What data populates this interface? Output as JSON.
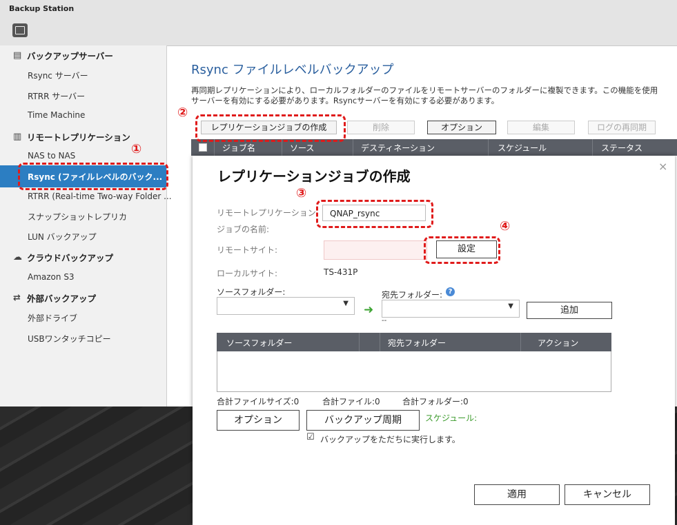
{
  "app": {
    "title": "Backup Station"
  },
  "sidebar": {
    "categories": [
      {
        "label": "バックアップサーバー",
        "icon": "server-icon"
      },
      {
        "label": "リモートレプリケーション",
        "icon": "replication-icon"
      },
      {
        "label": "クラウドバックアップ",
        "icon": "cloud-icon"
      },
      {
        "label": "外部バックアップ",
        "icon": "sync-icon"
      }
    ],
    "items": [
      "Rsync サーバー",
      "RTRR サーバー",
      "Time Machine",
      "NAS to NAS",
      "Rsync (ファイルレベルのバック...",
      "RTRR (Real-time Two-way Folder ...",
      "スナップショットレプリカ",
      "LUN バックアップ",
      "Amazon S3",
      "外部ドライブ",
      "USBワンタッチコピー"
    ]
  },
  "main": {
    "title": "Rsync ファイルレベルバックアップ",
    "description_line1": "再同期レプリケーションにより、ローカルフォルダーのファイルをリモートサーバーのフォルダーに複製できます。この機能を使用",
    "description_line2": "サーバーを有効にする必要があります。Rsyncサーバーを有効にする必要があります。",
    "toolbar": {
      "create": "レプリケーションジョブの作成",
      "delete": "削除",
      "options": "オプション",
      "edit": "編集",
      "resync_log": "ログの再同期"
    },
    "columns": [
      "ジョブ名",
      "ソース",
      "デスティネーション",
      "スケジュール",
      "ステータス"
    ]
  },
  "annotations": [
    "①",
    "②",
    "③",
    "④"
  ],
  "modal": {
    "title": "レプリケーションジョブの作成",
    "close_icon": "×",
    "job_name_label_1": "リモートレプリケーション",
    "job_name_label_2": "ジョブの名前:",
    "job_name_value": "QNAP_rsync",
    "remote_site_label": "リモートサイト:",
    "settings_button": "設定",
    "local_site_label": "ローカルサイト:",
    "local_site_value": "TS-431P",
    "source_folder_label": "ソースフォルダー:",
    "dest_folder_label": "宛先フォルダー:",
    "dest_hint": "--",
    "add_button": "追加",
    "table_columns": [
      "ソースフォルダー",
      "",
      "宛先フォルダー",
      "アクション"
    ],
    "total_size": "合計ファイルサイズ:0",
    "total_files": "合計ファイル:0",
    "total_folders": "合計フォルダー:0",
    "options_button": "オプション",
    "backup_schedule_button": "バックアップ周期",
    "schedule_label": "スケジュール:",
    "run_now_checkbox": "☑",
    "run_now_label": "バックアップをただちに実行します。",
    "apply_button": "適用",
    "cancel_button": "キャンセル"
  },
  "colors": {
    "accent": "#2c7ec2",
    "annotation": "#e01b1b",
    "schedule_green": "#3a9a2a"
  }
}
